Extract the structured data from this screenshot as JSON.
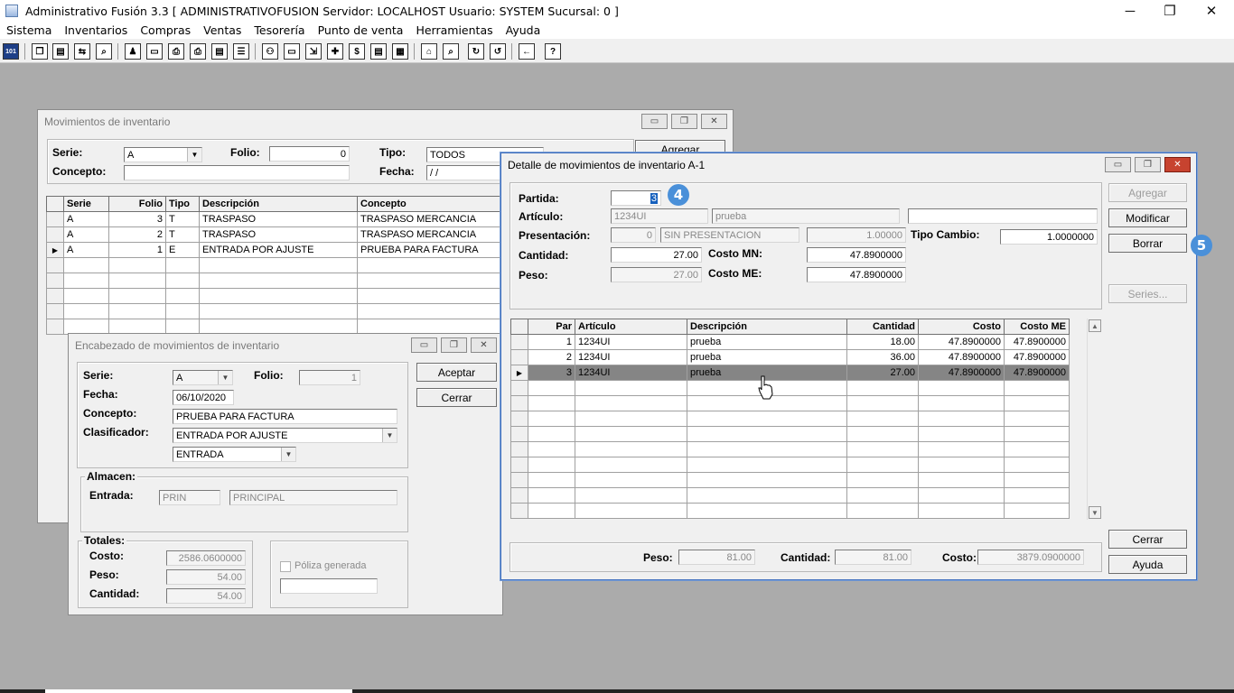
{
  "app": {
    "title": "Administrativo Fusión 3.3 [ ADMINISTRATIVOFUSION  Servidor: LOCALHOST  Usuario: SYSTEM    Sucursal: 0 ]",
    "controls": {
      "minimize": "─",
      "restore": "❐",
      "close": "✕"
    }
  },
  "menu": [
    "Sistema",
    "Inventarios",
    "Compras",
    "Ventas",
    "Tesorería",
    "Punto de venta",
    "Herramientas",
    "Ayuda"
  ],
  "mov": {
    "title": "Movimientos de inventario",
    "serie_label": "Serie:",
    "serie_value": "A",
    "folio_label": "Folio:",
    "folio_value": "0",
    "tipo_label": "Tipo:",
    "tipo_value": "TODOS",
    "concepto_label": "Concepto:",
    "fecha_label": "Fecha:",
    "fecha_value": "/ /",
    "agregar": "Agregar",
    "columns": [
      "Serie",
      "Folio",
      "Tipo",
      "Descripción",
      "Concepto"
    ],
    "rows": [
      {
        "serie": "A",
        "folio": "3",
        "tipo": "T",
        "descripcion": "TRASPASO",
        "concepto": "TRASPASO MERCANCIA"
      },
      {
        "serie": "A",
        "folio": "2",
        "tipo": "T",
        "descripcion": "TRASPASO",
        "concepto": "TRASPASO MERCANCIA"
      },
      {
        "serie": "A",
        "folio": "1",
        "tipo": "E",
        "descripcion": "ENTRADA POR AJUSTE",
        "concepto": "PRUEBA PARA FACTURA"
      }
    ]
  },
  "enc": {
    "title": "Encabezado de movimientos de inventario",
    "serie_label": "Serie:",
    "serie_value": "A",
    "folio_label": "Folio:",
    "folio_value": "1",
    "fecha_label": "Fecha:",
    "fecha_value": "06/10/2020",
    "concepto_label": "Concepto:",
    "concepto_value": "PRUEBA PARA FACTURA",
    "clasificador_label": "Clasificador:",
    "clasificador_value": "ENTRADA POR AJUSTE",
    "tipo_value": "ENTRADA",
    "aceptar": "Aceptar",
    "cerrar": "Cerrar",
    "almacen_label": "Almacen:",
    "entrada_label": "Entrada:",
    "entrada_code": "PRIN",
    "entrada_name": "PRINCIPAL",
    "totales_label": "Totales:",
    "costo_label": "Costo:",
    "costo_value": "2586.0600000",
    "peso_label": "Peso:",
    "peso_value": "54.00",
    "cantidad_label": "Cantidad:",
    "cantidad_value": "54.00",
    "poliza_label": "Póliza generada"
  },
  "det": {
    "title": "Detalle de movimientos de inventario A-1",
    "partida_label": "Partida:",
    "partida_value": "3",
    "articulo_label": "Artículo:",
    "articulo_code": "1234UI",
    "articulo_desc": "prueba",
    "presentacion_label": "Presentación:",
    "presentacion_num": "0",
    "presentacion_name": "SIN PRESENTACION",
    "presentacion_factor": "1.00000",
    "tipo_cambio_label": "Tipo Cambio:",
    "tipo_cambio_value": "1.0000000",
    "cantidad_label": "Cantidad:",
    "cantidad_value": "27.00",
    "costo_mn_label": "Costo MN:",
    "costo_mn_value": "47.8900000",
    "peso_label": "Peso:",
    "peso_value": "27.00",
    "costo_me_label": "Costo ME:",
    "costo_me_value": "47.8900000",
    "agregar": "Agregar",
    "modificar": "Modificar",
    "borrar": "Borrar",
    "series": "Series...",
    "cerrar": "Cerrar",
    "ayuda": "Ayuda",
    "columns": [
      "Par",
      "Artículo",
      "Descripción",
      "Cantidad",
      "Costo",
      "Costo ME"
    ],
    "rows": [
      {
        "par": "1",
        "articulo": "1234UI",
        "descripcion": "prueba",
        "cantidad": "18.00",
        "costo": "47.8900000",
        "costo_me": "47.8900000"
      },
      {
        "par": "2",
        "articulo": "1234UI",
        "descripcion": "prueba",
        "cantidad": "36.00",
        "costo": "47.8900000",
        "costo_me": "47.8900000"
      },
      {
        "par": "3",
        "articulo": "1234UI",
        "descripcion": "prueba",
        "cantidad": "27.00",
        "costo": "47.8900000",
        "costo_me": "47.8900000"
      }
    ],
    "footer_peso_label": "Peso:",
    "footer_peso_value": "81.00",
    "footer_cantidad_label": "Cantidad:",
    "footer_cantidad_value": "81.00",
    "footer_costo_label": "Costo:",
    "footer_costo_value": "3879.0900000"
  },
  "badges": {
    "b4": "4",
    "b5": "5"
  },
  "toolbar_icons": [
    "logo-icon",
    "copy-icon",
    "clipboard-icon",
    "transfer-icon",
    "search-doc-icon",
    "user-icon",
    "folder-icon",
    "print-icon",
    "printer-icon",
    "document-icon",
    "list-icon",
    "binoculars-icon",
    "box-icon",
    "export-icon",
    "add-icon",
    "dollar-icon",
    "report-icon",
    "calculator-icon",
    "home-icon",
    "search-icon",
    "refresh-icon",
    "undo-icon",
    "back-icon",
    "help-icon"
  ]
}
